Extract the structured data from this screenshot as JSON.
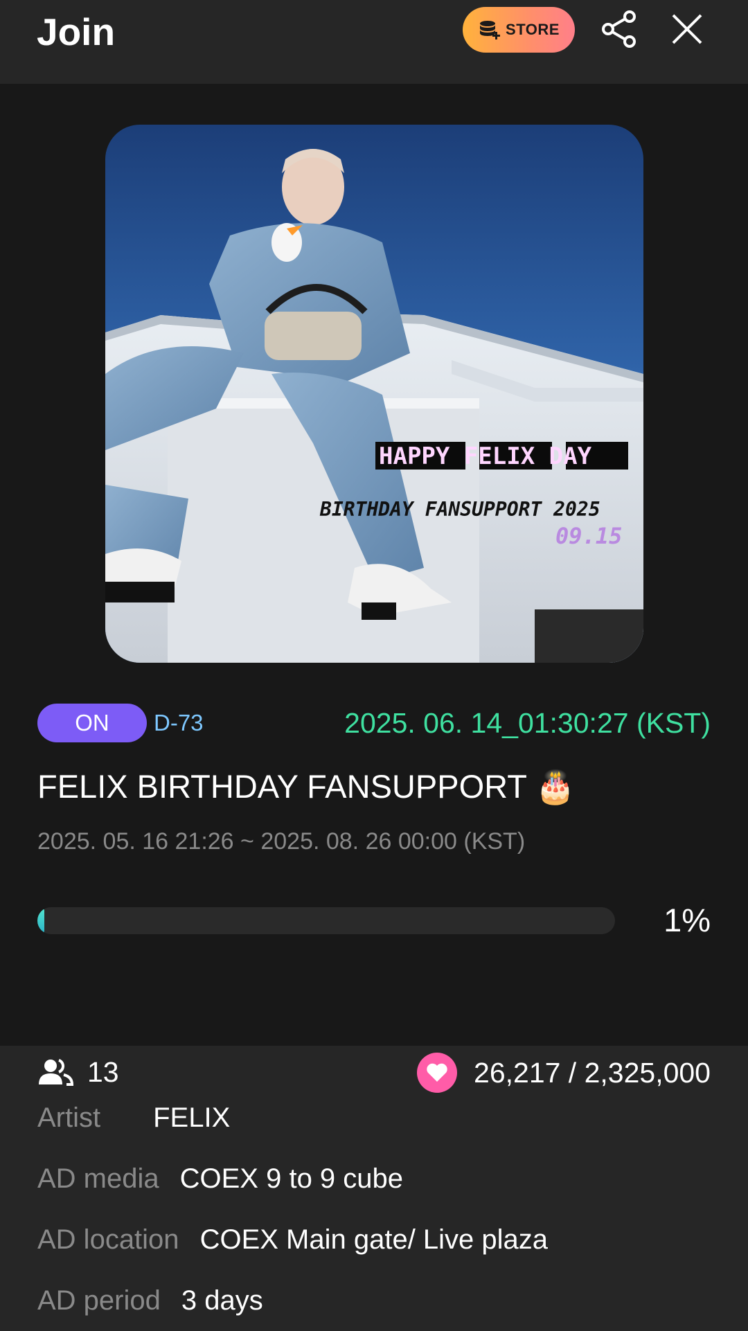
{
  "header": {
    "title": "Join",
    "store_label": "STORE"
  },
  "icons": {
    "store": "coin-stack-plus-icon",
    "share": "share-icon",
    "close": "close-icon",
    "users": "users-icon",
    "heart": "heart-icon"
  },
  "poster": {
    "headline": "HAPPY FELIX DAY",
    "subline": "BIRTHDAY FANSUPPORT 2025",
    "date": "09.15"
  },
  "event": {
    "status_badge": "ON",
    "dday": "D-73",
    "current_time": "2025. 06. 14_01:30:27 (KST)",
    "title": "FELIX BIRTHDAY FANSUPPORT",
    "title_emoji": "🎂",
    "period": "2025. 05. 16 21:26 ~ 2025. 08. 26 00:00 (KST)",
    "progress_percent": 1,
    "progress_label": "1%",
    "participants": "13",
    "hearts": "26,217 / 2,325,000"
  },
  "details": [
    {
      "label": "Artist",
      "value": "FELIX"
    },
    {
      "label": "AD media",
      "value": "COEX 9 to 9 cube"
    },
    {
      "label": "AD location",
      "value": "COEX Main gate/ Live plaza"
    },
    {
      "label": "AD period",
      "value": "3 days"
    }
  ],
  "colors": {
    "background": "#262626",
    "card": "#181818",
    "on_badge": "#7d5cf6",
    "dday": "#7ec8ff",
    "current_time": "#3fe0a0",
    "heart": "#ff5ca8",
    "progress_fill": "#3cc9cc"
  }
}
